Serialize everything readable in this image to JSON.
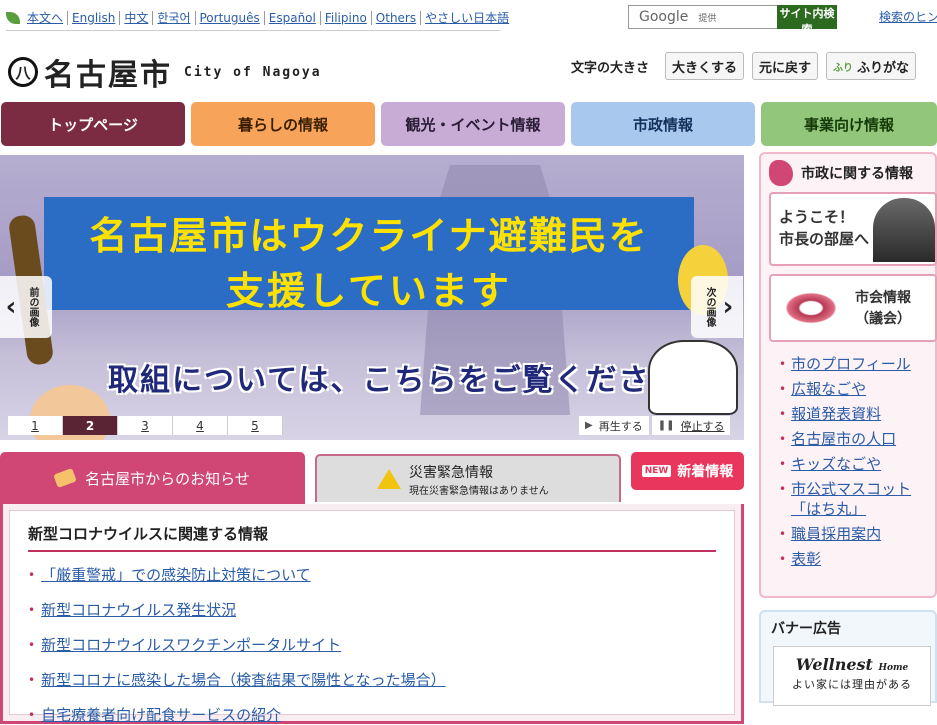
{
  "langbar": {
    "items": [
      "本文へ",
      "English",
      "中文",
      "한국어",
      "Português",
      "Español",
      "Filipino",
      "Others",
      "やさしい日本語"
    ]
  },
  "search": {
    "placeholder": "Google",
    "provided": "提供",
    "button": "サイト内検索",
    "hint": "検索のヒント"
  },
  "logo": {
    "mark": "八",
    "jp": "名古屋市",
    "en": "City of Nagoya"
  },
  "fontsize": {
    "label": "文字の大きさ",
    "bigger": "大きくする",
    "reset": "元に戻す",
    "furigana_icon": "ふり",
    "furigana": "ふりがな"
  },
  "nav": {
    "tabs": [
      "トップページ",
      "暮らしの情報",
      "観光・イベント情報",
      "市政情報",
      "事業向け情報"
    ]
  },
  "hero": {
    "headline1": "名古屋市はウクライナ避難民を",
    "headline2": "支援しています",
    "sub": "取組については、こちらをご覧ください",
    "prev": "前の画像",
    "next": "次の画像",
    "pages": [
      "1",
      "2",
      "3",
      "4",
      "5"
    ],
    "active_page": 2,
    "play": "再生する",
    "stop": "停止する"
  },
  "tabs": {
    "notice": "名古屋市からのお知らせ",
    "disaster": "災害緊急情報",
    "disaster_status": "現在災害緊急情報はありません",
    "new_badge": "NEW",
    "new": "新着情報"
  },
  "notice": {
    "title": "新型コロナウイルスに関連する情報",
    "items": [
      "「厳重警戒」での感染防止対策について",
      "新型コロナウイルス発生状況",
      "新型コロナウイルスワクチンポータルサイト",
      "新型コロナに感染した場合（検査結果で陽性となった場合）",
      "自宅療養者向け配食サービスの紹介"
    ]
  },
  "side": {
    "title": "市政に関する情報",
    "mayor": "ようこそ！市長の部屋へ",
    "mayor_l1": "ようこそ！",
    "mayor_l2": "市長の部屋へ",
    "council_l1": "市会情報",
    "council_l2": "（議会）",
    "links": [
      "市のプロフィール",
      "広報なごや",
      "報道発表資料",
      "名古屋市の人口",
      "キッズなごや",
      "市公式マスコット「はち丸」",
      "職員採用案内",
      "表彰"
    ]
  },
  "banner": {
    "title": "バナー広告",
    "ad_logo": "Wellnest",
    "ad_logo_small": "Home",
    "ad_tag": "よい家には理由がある"
  }
}
